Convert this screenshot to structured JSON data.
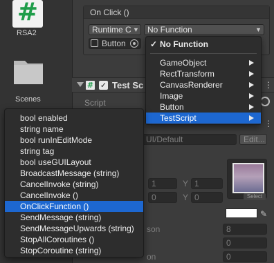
{
  "project": {
    "assets": [
      {
        "label": "RSA2",
        "icon": "csharp-script-icon"
      },
      {
        "label": "Scenes",
        "icon": "folder-icon"
      }
    ]
  },
  "event": {
    "title": "On Click ()",
    "runtime_label": "Runtime C",
    "function_label": "No Function",
    "object_label": "Button"
  },
  "component": {
    "title": "Test Sc",
    "script_label": "Script"
  },
  "inspector": {
    "uidefault": "UI/Default",
    "edit_label": "Edit...",
    "x_label": "X",
    "y_label": "Y",
    "xy_1_x": "1",
    "xy_1_y": "1",
    "xy_2_x": "0",
    "xy_2_y": "0",
    "thumb_select": "Select",
    "son_label": "son",
    "on_label": "on",
    "val_8": "8",
    "val_0a": "0",
    "val_0b": "0",
    "swatch_color": "#ffffff"
  },
  "function_menu": {
    "items": [
      {
        "label": "No Function",
        "check": "✓"
      },
      {
        "label": "GameObject"
      },
      {
        "label": "RectTransform"
      },
      {
        "label": "CanvasRenderer"
      },
      {
        "label": "Image"
      },
      {
        "label": "Button"
      },
      {
        "label": "TestScript"
      }
    ]
  },
  "member_menu": {
    "items": [
      "bool enabled",
      "string name",
      "bool runInEditMode",
      "string tag",
      "bool useGUILayout",
      "BroadcastMessage (string)",
      "CancelInvoke (string)",
      "CancelInvoke ()",
      "OnClickFunction ()",
      "SendMessage (string)",
      "SendMessageUpwards (string)",
      "StopAllCoroutines ()",
      "StopCoroutine (string)"
    ]
  },
  "colors": {
    "selection": "#1d67d0",
    "csharp_green": "#1f9d4a",
    "menu_bg": "#2d2d2d"
  }
}
